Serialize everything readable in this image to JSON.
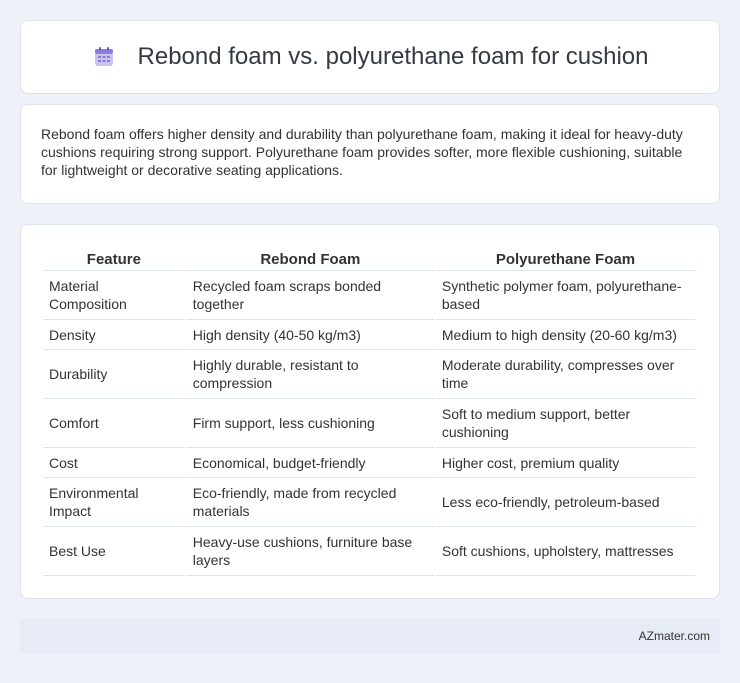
{
  "header": {
    "title": "Rebond foam vs. polyurethane foam for cushion",
    "icon": "calendar-icon"
  },
  "summary": {
    "text": "Rebond foam offers higher density and durability than polyurethane foam, making it ideal for heavy-duty cushions requiring strong support. Polyurethane foam provides softer, more flexible cushioning, suitable for lightweight or decorative seating applications."
  },
  "table": {
    "headers": [
      "Feature",
      "Rebond Foam",
      "Polyurethane Foam"
    ],
    "rows": [
      [
        "Material Composition",
        "Recycled foam scraps bonded together",
        "Synthetic polymer foam, polyurethane-based"
      ],
      [
        "Density",
        "High density (40-50 kg/m3)",
        "Medium to high density (20-60 kg/m3)"
      ],
      [
        "Durability",
        "Highly durable, resistant to compression",
        "Moderate durability, compresses over time"
      ],
      [
        "Comfort",
        "Firm support, less cushioning",
        "Soft to medium support, better cushioning"
      ],
      [
        "Cost",
        "Economical, budget-friendly",
        "Higher cost, premium quality"
      ],
      [
        "Environmental Impact",
        "Eco-friendly, made from recycled materials",
        "Less eco-friendly, petroleum-based"
      ],
      [
        "Best Use",
        "Heavy-use cushions, furniture base layers",
        "Soft cushions, upholstery, mattresses"
      ]
    ]
  },
  "footer": {
    "brand": "AZmater.com"
  },
  "colors": {
    "background": "#eef1f8",
    "card": "#ffffff",
    "footer": "#e6ebf6",
    "icon_accent": "#8a7fd8"
  }
}
